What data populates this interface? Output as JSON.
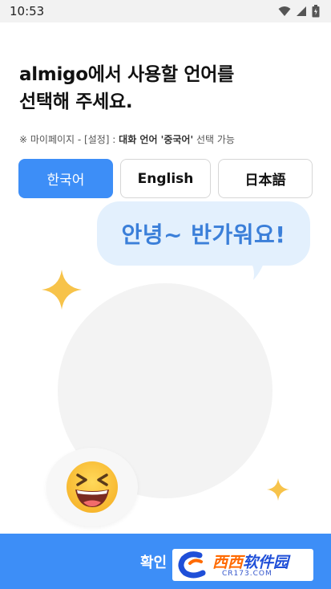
{
  "status_bar": {
    "time": "10:53",
    "icons": [
      "wifi-icon",
      "signal-icon",
      "battery-icon"
    ]
  },
  "heading": {
    "line1": "almigo에서 사용할 언어를",
    "line2": "선택해 주세요."
  },
  "note": {
    "prefix": "※ 마이페이지 - [설정] : ",
    "bold": "대화 언어 '중국어'",
    "suffix": " 선택 가능"
  },
  "languages": [
    {
      "label": "한국어",
      "selected": true
    },
    {
      "label": "English",
      "selected": false
    },
    {
      "label": "日本語",
      "selected": false
    }
  ],
  "speech_bubble": {
    "text": "안녕~ 반가워요!"
  },
  "confirm_button": {
    "label": "확인"
  },
  "watermark": {
    "main_left": "西西",
    "main_right": "软件园",
    "sub": "CR173.COM"
  },
  "colors": {
    "accent": "#3d8ef7",
    "bubble_bg": "#e3f0fd",
    "bubble_text": "#3b7fd9",
    "sparkle": "#f7c34a"
  }
}
